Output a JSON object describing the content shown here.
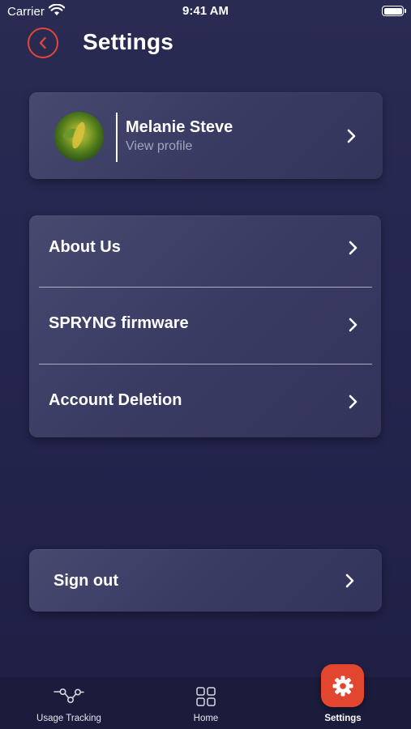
{
  "status_bar": {
    "carrier": "Carrier",
    "time": "9:41 AM"
  },
  "header": {
    "title": "Settings",
    "back_icon": "chevron-left-icon",
    "accent_color": "#e2463a"
  },
  "profile": {
    "name": "Melanie Steve",
    "subtitle": "View profile"
  },
  "menu": {
    "items": [
      {
        "label": "About Us"
      },
      {
        "label": "SPRYNG firmware"
      },
      {
        "label": "Account Deletion"
      }
    ]
  },
  "sign_out": {
    "label": "Sign out"
  },
  "tab_bar": {
    "tabs": [
      {
        "label": "Usage Tracking",
        "icon": "usage-tracking-icon"
      },
      {
        "label": "Home",
        "icon": "grid-icon"
      },
      {
        "label": "Settings",
        "icon": "gear-icon",
        "active": true
      }
    ],
    "active_color": "#e2462e"
  }
}
